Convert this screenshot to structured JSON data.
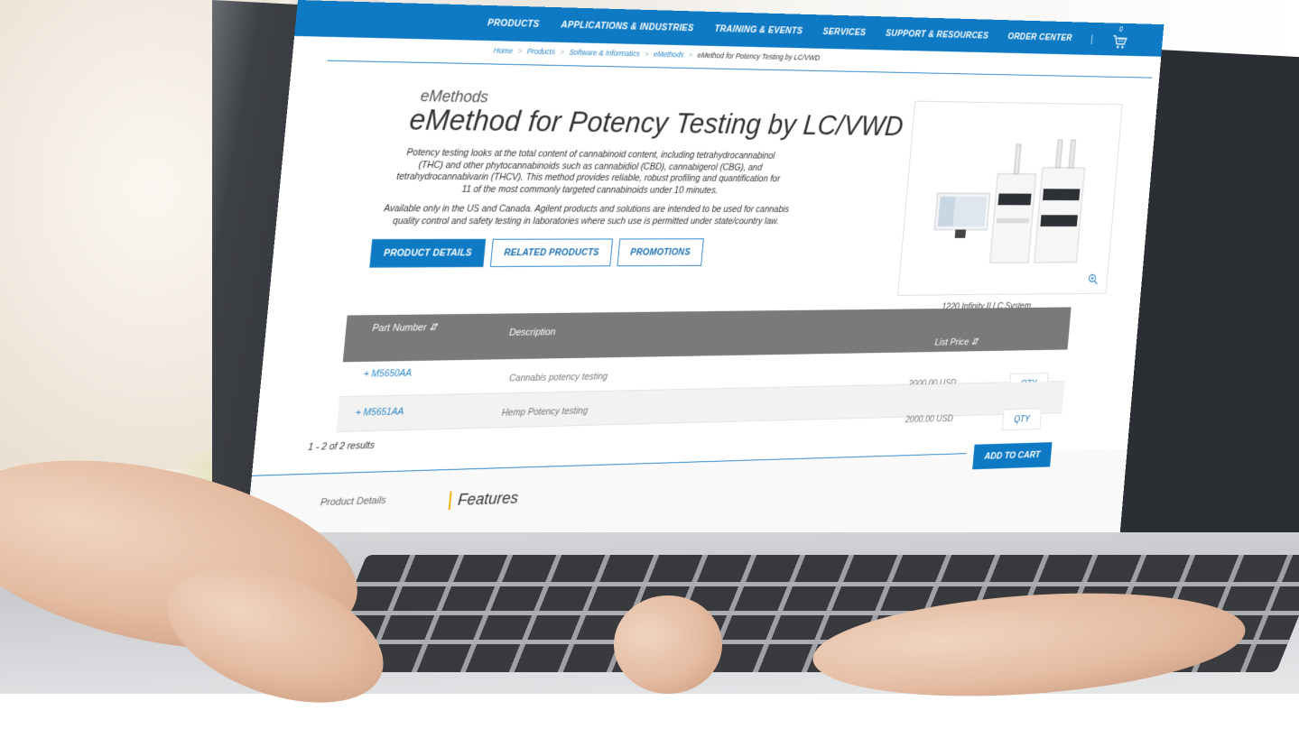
{
  "nav": {
    "items": [
      {
        "label": "PRODUCTS"
      },
      {
        "label": "APPLICATIONS & INDUSTRIES"
      },
      {
        "label": "TRAINING & EVENTS"
      },
      {
        "label": "SERVICES"
      },
      {
        "label": "SUPPORT & RESOURCES"
      },
      {
        "label": "ORDER CENTER"
      }
    ],
    "separator": "|",
    "cart_count": "0",
    "cart_icon": "cart-icon"
  },
  "breadcrumb": {
    "items": [
      "Home",
      "Products",
      "Software & Informatics",
      "eMethods"
    ],
    "separator": ">",
    "current": "eMethod for Potency Testing by LC/VWD"
  },
  "product": {
    "category": "eMethods",
    "title": "eMethod for Potency Testing by LC/VWD",
    "description": "Potency testing looks at the total content of cannabinoid content, including tetrahydrocannabinol (THC) and other phytocannabinoids such as cannabidiol (CBD), cannabigerol (CBG), and tetrahydrocannabivarin (THCV). This method provides reliable, robust profiling and quantification for 11 of the most commonly targeted cannabinoids under 10 minutes.",
    "availability": "Available only in the US and Canada. Agilent products and solutions are intended to be used for cannabis quality control and safety testing in laboratories where such use is permitted under state/country law.",
    "image_caption": "1220 Infinity II LC System",
    "zoom_icon": "zoom-in-icon"
  },
  "tabs": [
    {
      "label": "PRODUCT DETAILS",
      "active": true
    },
    {
      "label": "RELATED PRODUCTS",
      "active": false
    },
    {
      "label": "PROMOTIONS",
      "active": false
    }
  ],
  "table": {
    "headers": {
      "part_number": "Part Number",
      "description": "Description",
      "list_price": "List Price"
    },
    "sort_icon": "sort-icon",
    "rows": [
      {
        "part": "+ M5650AA",
        "description": "Cannabis potency testing",
        "price": "2000.00 USD",
        "qty_label": "QTY"
      },
      {
        "part": "+ M5651AA",
        "description": "Hemp Potency testing",
        "price": "2000.00 USD",
        "qty_label": "QTY"
      }
    ]
  },
  "results_text": "1 - 2 of 2 results",
  "add_to_cart_label": "ADD TO CART",
  "bottom": {
    "product_details_label": "Product Details",
    "features_heading": "Features"
  },
  "colors": {
    "brand_blue": "#0e7ac4",
    "table_header_gray": "#7a7a7a",
    "accent_yellow": "#f0b000"
  }
}
